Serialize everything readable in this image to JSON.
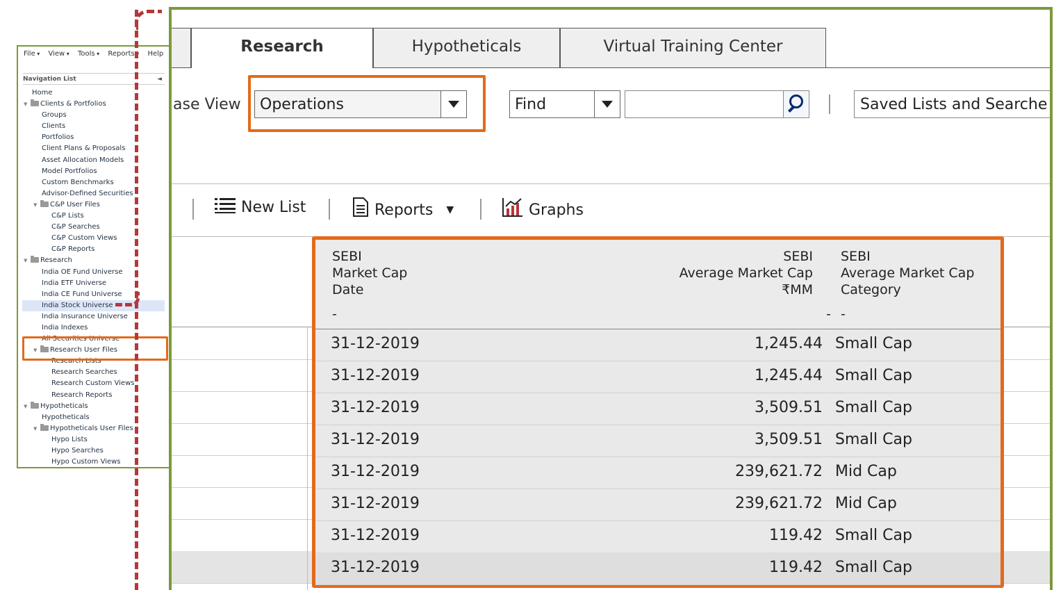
{
  "menu": [
    "File",
    "View",
    "Tools",
    "Reports",
    "Help"
  ],
  "navigation": {
    "header": "Navigation List",
    "collapse": "◄",
    "items": [
      {
        "label": "Home",
        "level": 1
      },
      {
        "label": "Clients & Portfolios",
        "level": 1,
        "folder": true
      },
      {
        "label": "Groups",
        "level": 2
      },
      {
        "label": "Clients",
        "level": 2
      },
      {
        "label": "Portfolios",
        "level": 2
      },
      {
        "label": "Client Plans & Proposals",
        "level": 2
      },
      {
        "label": "Asset Allocation Models",
        "level": 2
      },
      {
        "label": "Model Portfolios",
        "level": 2
      },
      {
        "label": "Custom Benchmarks",
        "level": 2
      },
      {
        "label": "Advisor-Defined Securities",
        "level": 2
      },
      {
        "label": "C&P User Files",
        "level": 2,
        "folder": true
      },
      {
        "label": "C&P Lists",
        "level": 3
      },
      {
        "label": "C&P Searches",
        "level": 3
      },
      {
        "label": "C&P Custom Views",
        "level": 3
      },
      {
        "label": "C&P Reports",
        "level": 3
      },
      {
        "label": "Research",
        "level": 1,
        "folder": true
      },
      {
        "label": "India OE Fund Universe",
        "level": 2
      },
      {
        "label": "India ETF Universe",
        "level": 2
      },
      {
        "label": "India CE Fund Universe",
        "level": 2
      },
      {
        "label": "India Stock Universe",
        "level": 2,
        "selected": true
      },
      {
        "label": "India Insurance Universe",
        "level": 2
      },
      {
        "label": "India Indexes",
        "level": 2
      },
      {
        "label": "All Securities Universe",
        "level": 2
      },
      {
        "label": "Research User Files",
        "level": 2,
        "folder": true
      },
      {
        "label": "Research Lists",
        "level": 3
      },
      {
        "label": "Research Searches",
        "level": 3
      },
      {
        "label": "Research Custom Views",
        "level": 3
      },
      {
        "label": "Research Reports",
        "level": 3
      },
      {
        "label": "Hypotheticals",
        "level": 1,
        "folder": true
      },
      {
        "label": "Hypotheticals",
        "level": 2
      },
      {
        "label": "Hypotheticals User Files",
        "level": 2,
        "folder": true
      },
      {
        "label": "Hypo Lists",
        "level": 3
      },
      {
        "label": "Hypo Searches",
        "level": 3
      },
      {
        "label": "Hypo Custom Views",
        "level": 3
      }
    ]
  },
  "tabs": {
    "research": "Research",
    "hypotheticals": "Hypotheticals",
    "virtual_training": "Virtual Training Center"
  },
  "view": {
    "label": "ase View",
    "selected": "Operations"
  },
  "find": {
    "selected": "Find",
    "value": ""
  },
  "saved_lists": "Saved Lists and Searche",
  "toolbar": {
    "new_list": "New List",
    "reports": "Reports",
    "graphs": "Graphs"
  },
  "table": {
    "headers": {
      "col1": "SEBI\nMarket Cap\nDate",
      "col2": "SEBI\nAverage Market Cap\n₹MM",
      "col3": "SEBI\nAverage Market Cap\nCategory"
    },
    "filters": {
      "col1": "-",
      "col2": "-",
      "col3": "-"
    },
    "rows": [
      {
        "date": "31-12-2019",
        "cap": "1,245.44",
        "category": "Small Cap"
      },
      {
        "date": "31-12-2019",
        "cap": "1,245.44",
        "category": "Small Cap"
      },
      {
        "date": "31-12-2019",
        "cap": "3,509.51",
        "category": "Small Cap"
      },
      {
        "date": "31-12-2019",
        "cap": "3,509.51",
        "category": "Small Cap"
      },
      {
        "date": "31-12-2019",
        "cap": "239,621.72",
        "category": "Mid Cap"
      },
      {
        "date": "31-12-2019",
        "cap": "239,621.72",
        "category": "Mid Cap"
      },
      {
        "date": "31-12-2019",
        "cap": "119.42",
        "category": "Small Cap"
      },
      {
        "date": "31-12-2019",
        "cap": "119.42",
        "category": "Small Cap"
      }
    ]
  },
  "colors": {
    "highlight": "#e26a1b",
    "frame": "#7a9a3a",
    "connector": "#b5373b"
  }
}
